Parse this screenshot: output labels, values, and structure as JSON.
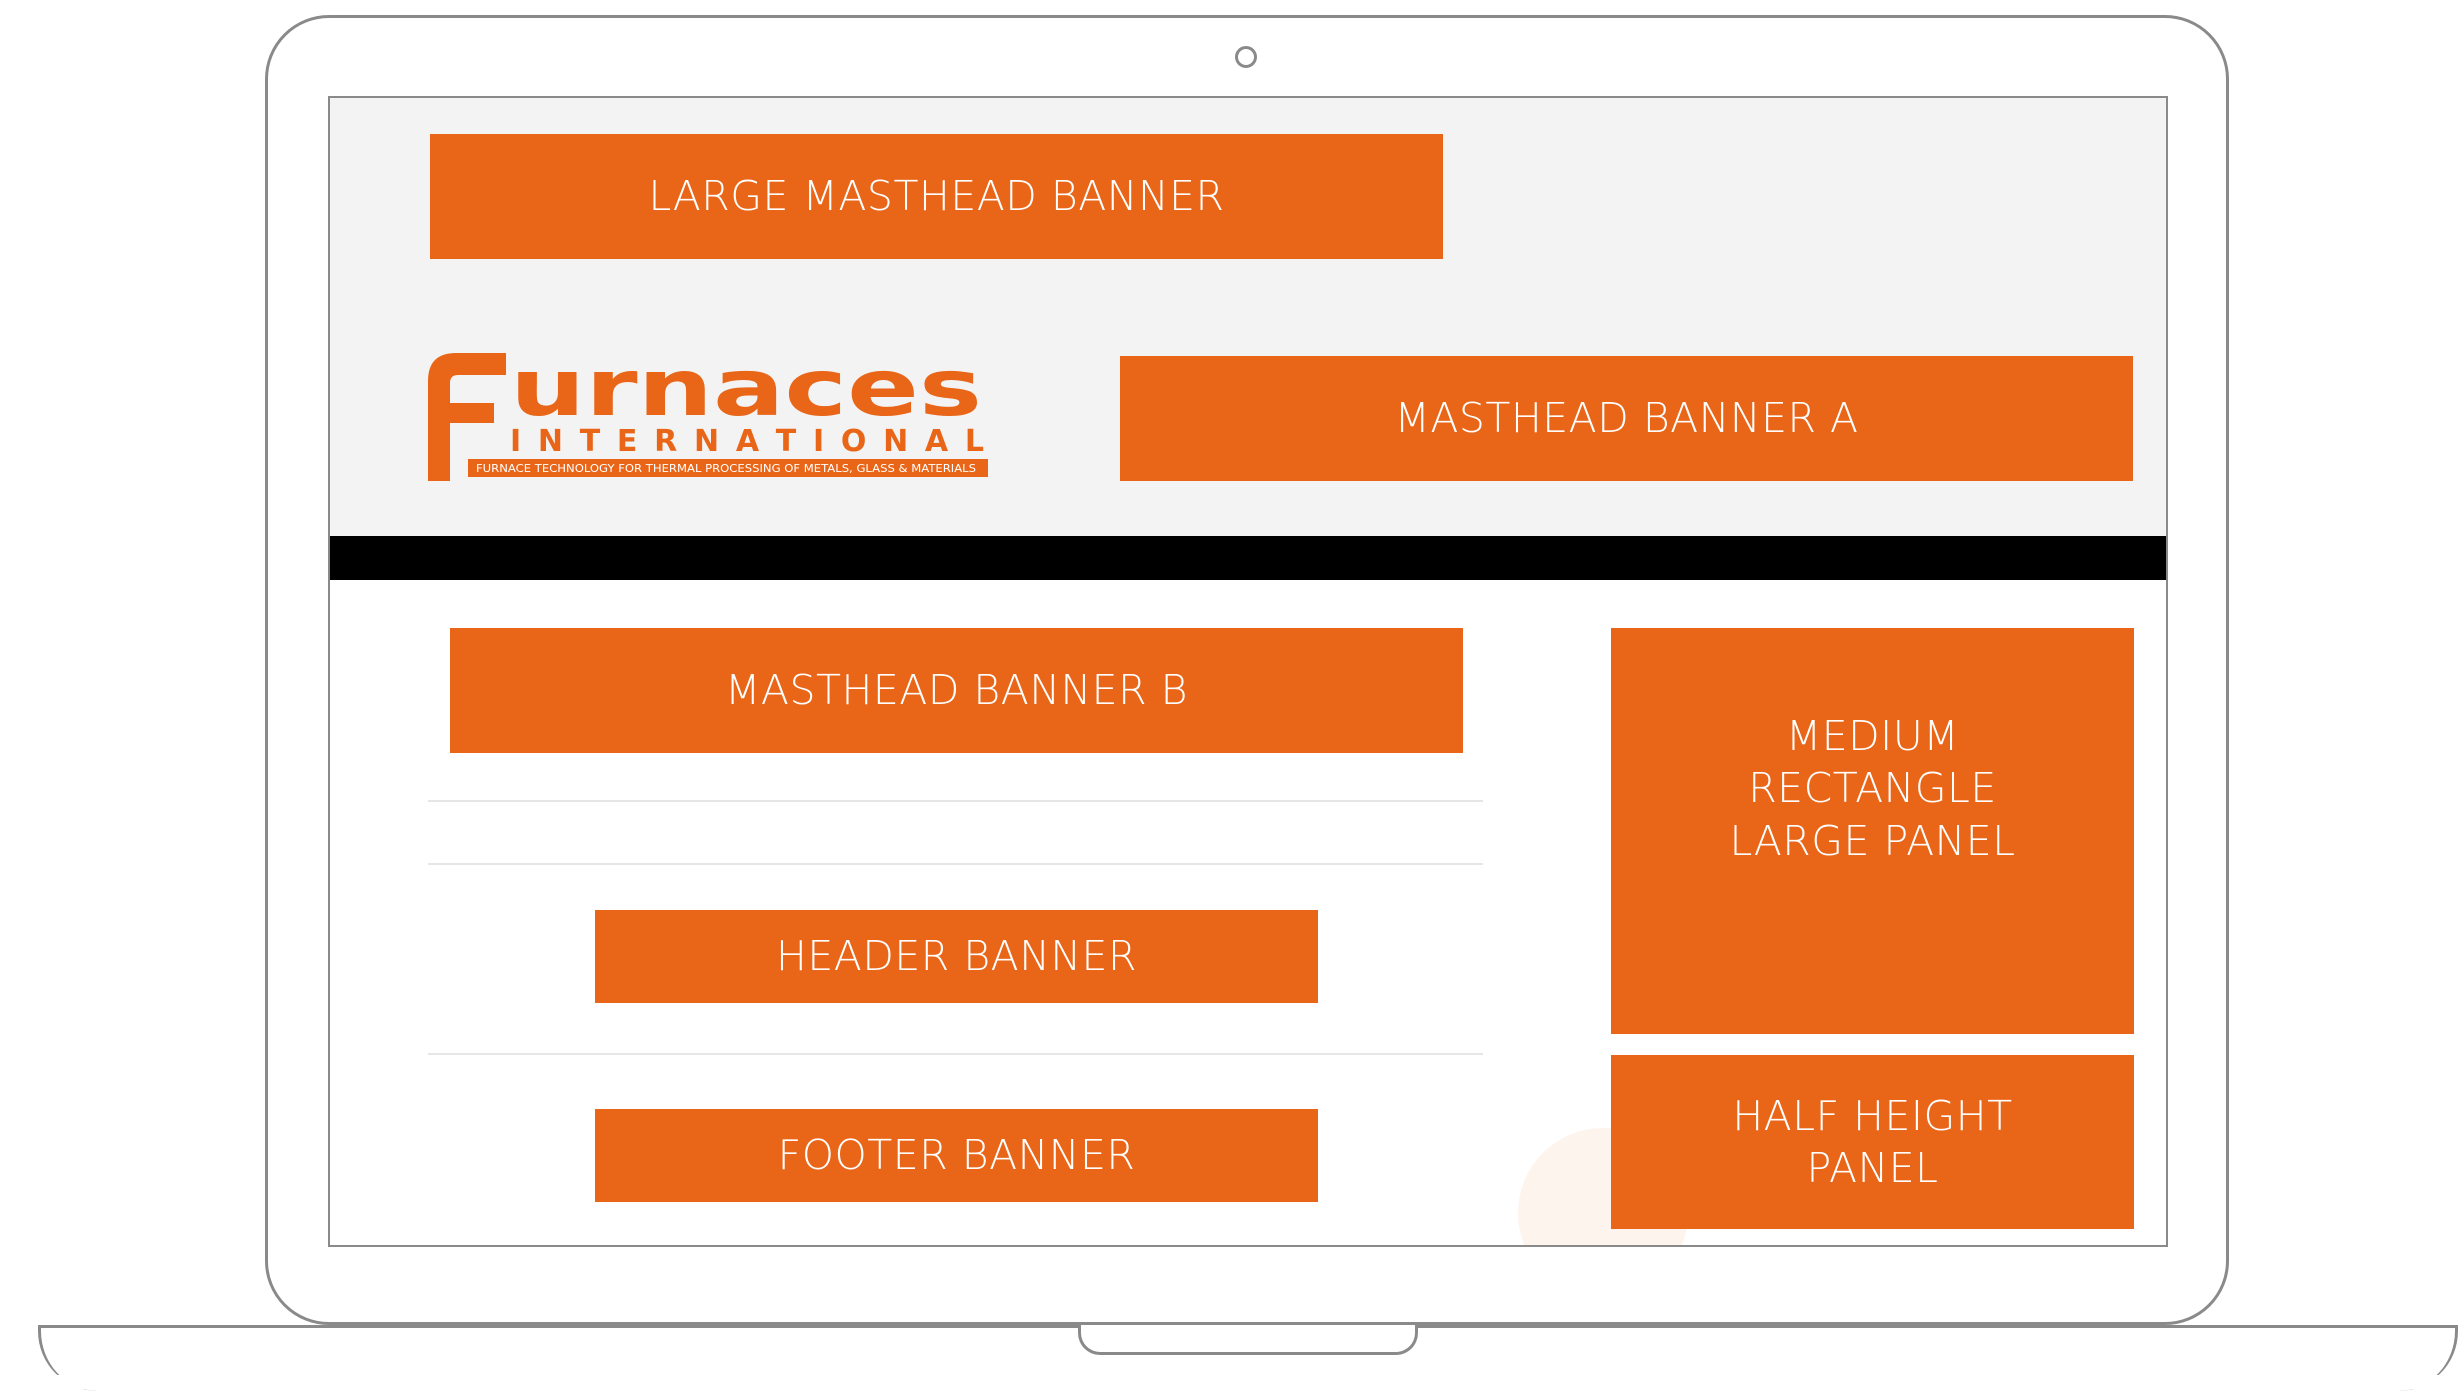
{
  "logo": {
    "brand": "Furnaces",
    "sub": "INTERNATIONAL",
    "tagline": "FURNACE TECHNOLOGY FOR THERMAL PROCESSING OF METALS, GLASS & MATERIALS"
  },
  "banners": {
    "large_masthead": "LARGE MASTHEAD BANNER",
    "masthead_a": "MASTHEAD BANNER A",
    "masthead_b": "MASTHEAD BANNER B",
    "header": "HEADER BANNER",
    "footer": "FOOTER BANNER",
    "medium_rectangle": [
      "MEDIUM",
      "RECTANGLE",
      "LARGE PANEL"
    ],
    "half_height": [
      "HALF HEIGHT",
      "PANEL"
    ]
  },
  "colors": {
    "accent": "#e96518",
    "header_bg": "#f3f3f3",
    "nav_bar": "#000000",
    "frame": "#8a8a8a"
  }
}
